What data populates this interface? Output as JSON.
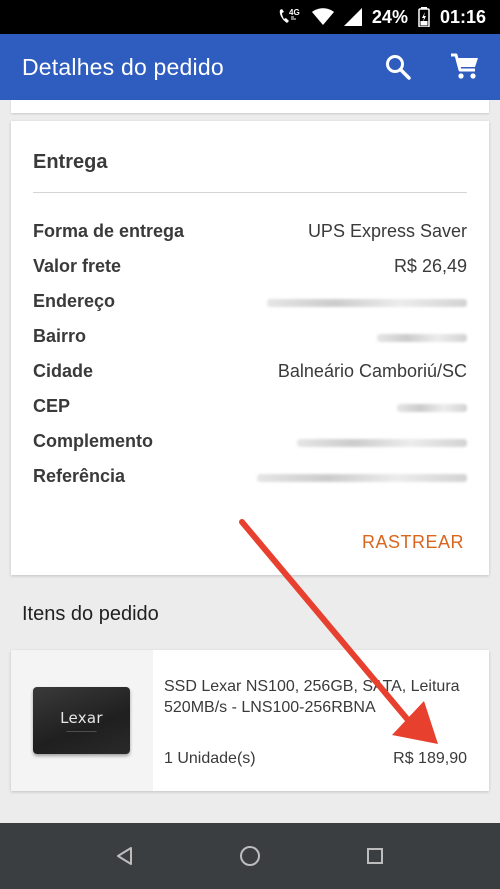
{
  "status_bar": {
    "network": "4G",
    "battery": "24%",
    "time": "01:16"
  },
  "app_bar": {
    "title": "Detalhes do pedido",
    "icons": [
      "search-icon",
      "cart-icon"
    ]
  },
  "delivery": {
    "title": "Entrega",
    "rows": [
      {
        "label": "Forma de entrega",
        "value": "UPS Express Saver"
      },
      {
        "label": "Valor frete",
        "value": "R$ 26,49"
      },
      {
        "label": "Endereço",
        "value": ""
      },
      {
        "label": "Bairro",
        "value": ""
      },
      {
        "label": "Cidade",
        "value": "Balneário Camboriú/SC"
      },
      {
        "label": "CEP",
        "value": ""
      },
      {
        "label": "Complemento",
        "value": ""
      },
      {
        "label": "Referência",
        "value": ""
      }
    ],
    "track_label": "RASTREAR"
  },
  "items": {
    "title": "Itens do pedido",
    "list": [
      {
        "image_brand": "Lexar",
        "name": "SSD Lexar NS100, 256GB, SATA, Leitura 520MB/s - LNS100-256RBNA",
        "quantity": "1 Unidade(s)",
        "price": "R$ 189,90"
      }
    ]
  },
  "colors": {
    "app_bar": "#2f5dbf",
    "accent": "#d9661f",
    "annotation_arrow": "#e8402e",
    "nav_bar": "#3b3e41"
  },
  "nav_bar": {
    "icons": [
      "back-icon",
      "home-icon",
      "recents-icon"
    ]
  }
}
